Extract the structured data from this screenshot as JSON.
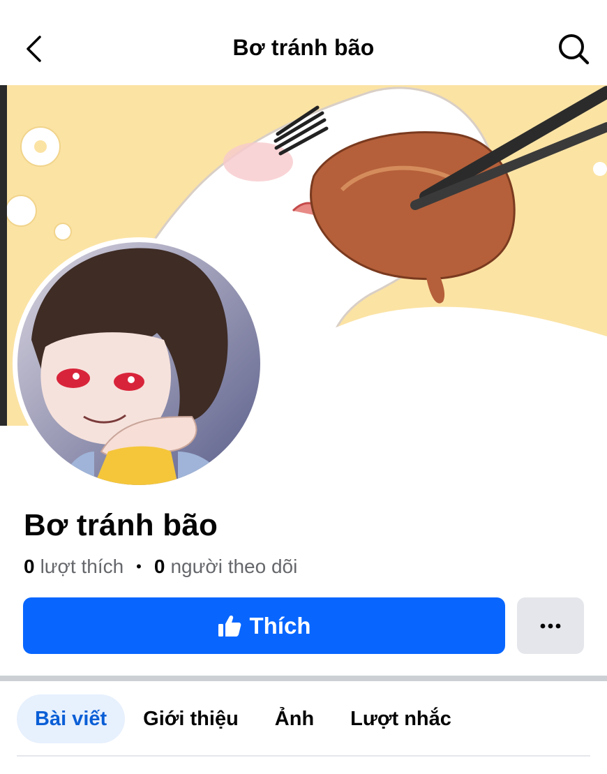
{
  "header": {
    "title": "Bơ tránh bão",
    "back_icon": "chevron-left-icon",
    "search_icon": "search-icon"
  },
  "profile": {
    "name": "Bơ tránh bão",
    "likes_count": "0",
    "likes_label": "lượt thích",
    "separator": "•",
    "followers_count": "0",
    "followers_label": "người theo dõi"
  },
  "actions": {
    "like_label": "Thích",
    "like_icon": "thumbs-up-icon",
    "more_icon": "more-icon",
    "primary_color": "#0866ff"
  },
  "tabs": [
    {
      "label": "Bài viết",
      "active": true
    },
    {
      "label": "Giới thiệu",
      "active": false
    },
    {
      "label": "Ảnh",
      "active": false
    },
    {
      "label": "Lượt nhắc",
      "active": false
    }
  ]
}
